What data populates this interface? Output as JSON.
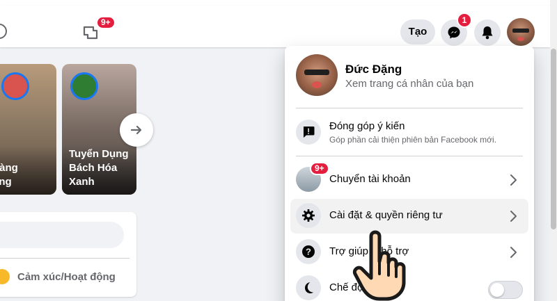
{
  "nav": {
    "gaming_badge": "9+",
    "create_label": "Tạo",
    "messenger_badge": "1",
    "messenger_icon": "messenger-icon",
    "notifications_icon": "bell-icon"
  },
  "stories": [
    {
      "text_lines": [
        "oàng",
        "ang"
      ]
    },
    {
      "text_lines": [
        "Tuyển Dụng",
        "Bách Hóa",
        "Xanh"
      ]
    }
  ],
  "composer": {
    "feeling_label": "Cảm xúc/Hoạt động"
  },
  "account_menu": {
    "profile": {
      "name": "Đức Đặng",
      "subtitle": "Xem trang cá nhân của bạn"
    },
    "items": [
      {
        "label": "Đóng góp ý kiến",
        "sublabel": "Góp phần cải thiện phiên bản Facebook mới.",
        "icon": "feedback-icon"
      },
      {
        "label": "Chuyển tài khoản",
        "badge": "9+",
        "icon": "account-avatar",
        "chevron": true
      },
      {
        "label": "Cài đặt & quyền riêng tư",
        "icon": "gear-icon",
        "chevron": true,
        "highlighted": true
      },
      {
        "label": "Trợ giúp & hỗ trợ",
        "icon": "help-icon",
        "chevron": true
      },
      {
        "label": "Chế độ tối",
        "icon": "moon-icon",
        "toggle": false
      }
    ]
  },
  "colors": {
    "accent": "#1877f2",
    "badge": "#e41e3f",
    "icon_bg": "#e4e6eb",
    "page_bg": "#f0f2f5"
  }
}
